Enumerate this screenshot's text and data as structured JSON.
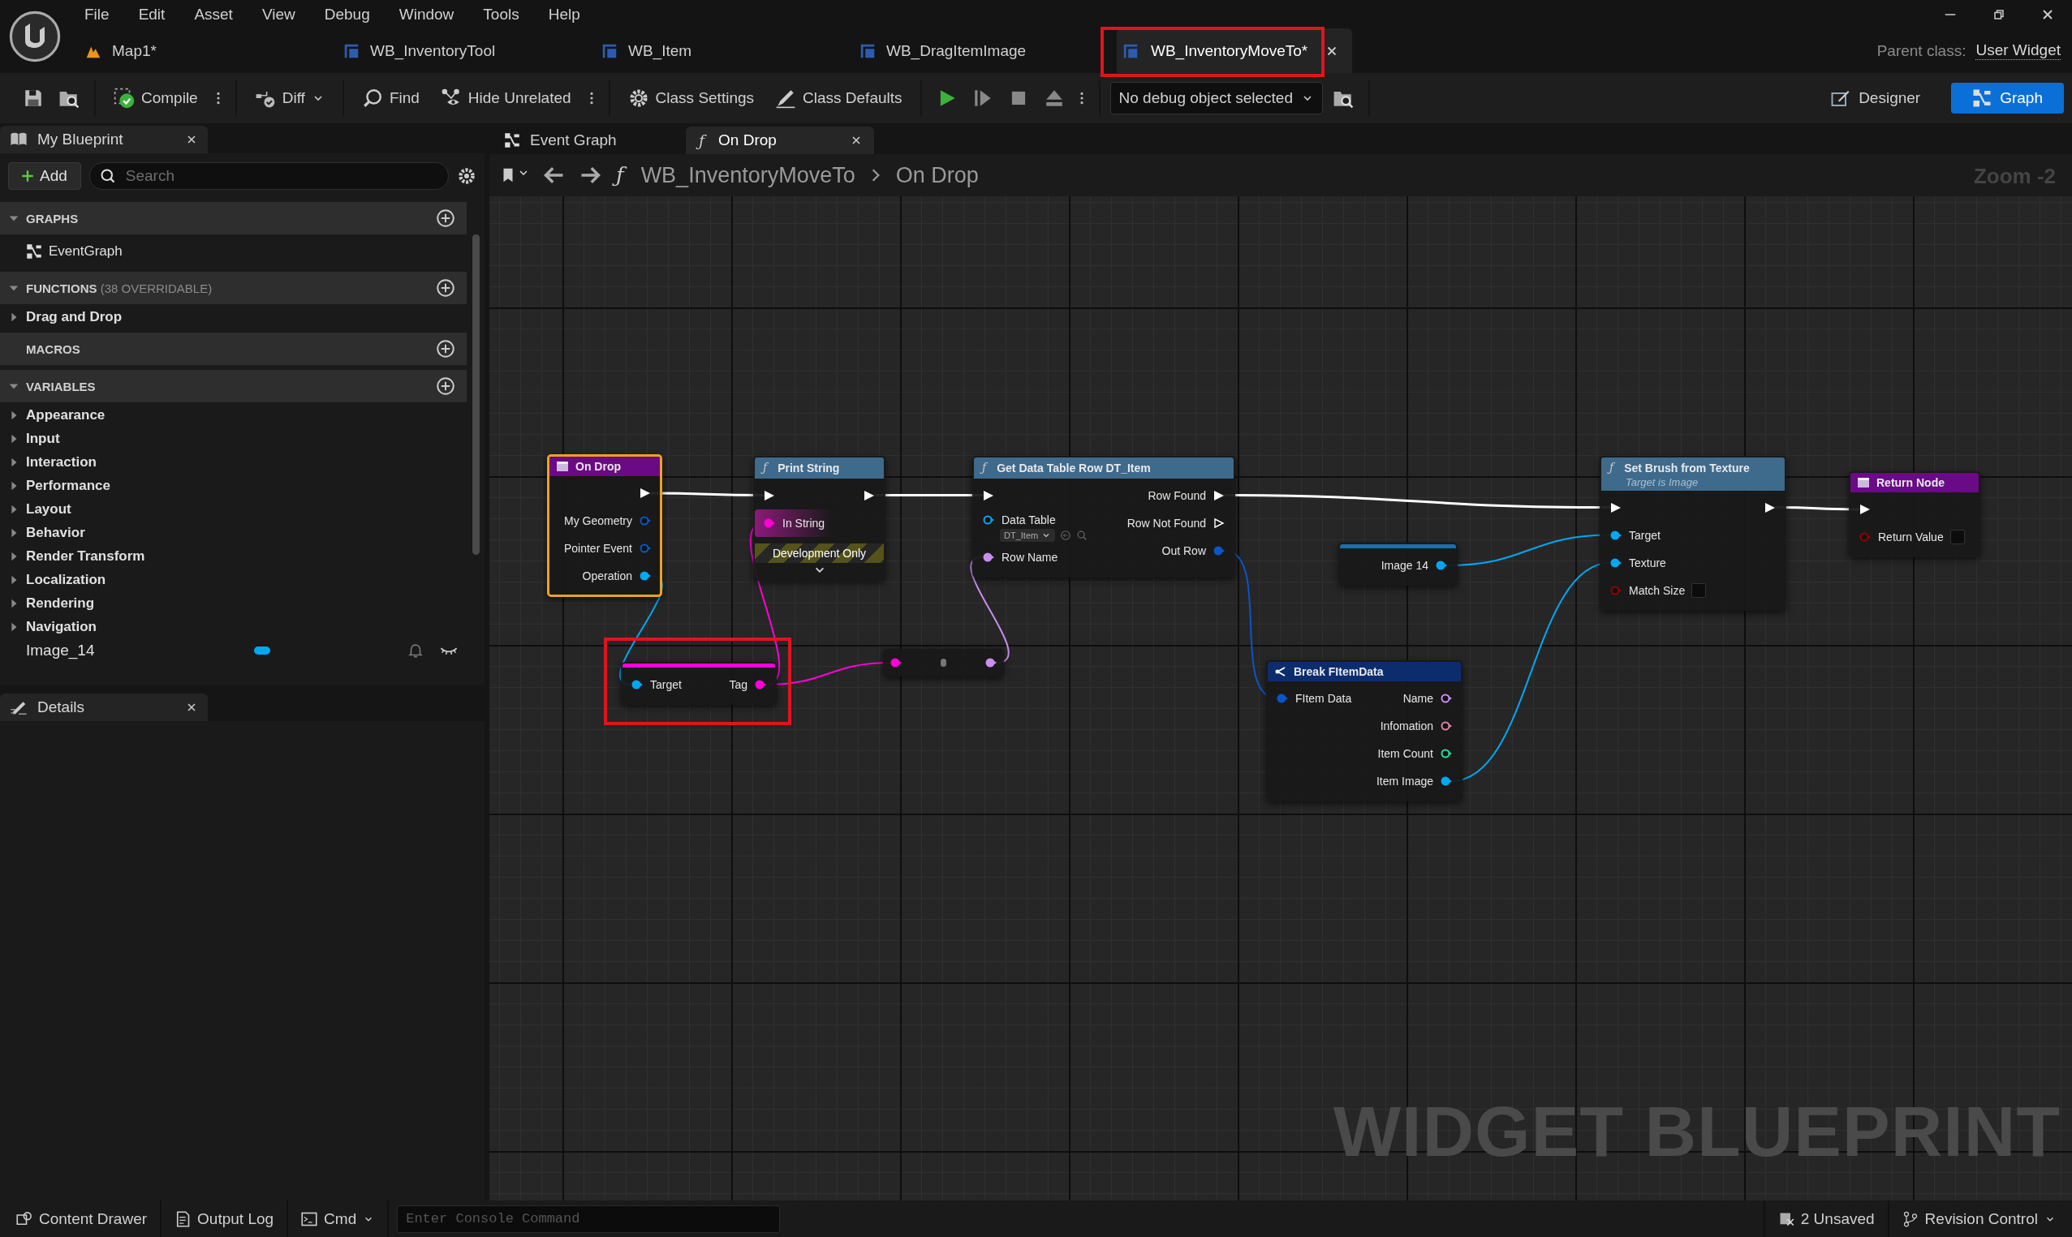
{
  "menu": [
    "File",
    "Edit",
    "Asset",
    "View",
    "Debug",
    "Window",
    "Tools",
    "Help"
  ],
  "doc_tabs": [
    {
      "label": "Map1*",
      "kind": "level",
      "selected": false,
      "highlighted": false
    },
    {
      "label": "WB_InventoryTool",
      "kind": "widget",
      "selected": false,
      "highlighted": false
    },
    {
      "label": "WB_Item",
      "kind": "widget",
      "selected": false,
      "highlighted": false
    },
    {
      "label": "WB_DragItemImage",
      "kind": "widget",
      "selected": false,
      "highlighted": false
    },
    {
      "label": "WB_InventoryMoveTo*",
      "kind": "widget",
      "selected": true,
      "highlighted": true
    }
  ],
  "parent_class": {
    "label": "Parent class:",
    "value": "User Widget"
  },
  "toolbar": [
    [
      {
        "kind": "save"
      },
      {
        "kind": "browse"
      }
    ],
    [
      {
        "kind": "compile",
        "label": "Compile"
      },
      {
        "kind": "more"
      }
    ],
    [
      {
        "kind": "diff",
        "label": "Diff"
      }
    ],
    [
      {
        "kind": "find",
        "label": "Find"
      },
      {
        "kind": "hide",
        "label": "Hide Unrelated"
      },
      {
        "kind": "more"
      }
    ],
    [
      {
        "kind": "settings",
        "label": "Class Settings"
      },
      {
        "kind": "defaults",
        "label": "Class Defaults"
      }
    ],
    [
      {
        "kind": "play"
      },
      {
        "kind": "step"
      },
      {
        "kind": "stop"
      },
      {
        "kind": "eject"
      },
      {
        "kind": "more"
      }
    ],
    [
      {
        "kind": "debug",
        "label": "No debug object selected"
      },
      {
        "kind": "browse"
      }
    ]
  ],
  "modes": [
    {
      "label": "Designer",
      "kind": "designer",
      "selected": false
    },
    {
      "label": "Graph",
      "kind": "graph",
      "selected": true
    }
  ],
  "my_blueprint": {
    "title": "My Blueprint",
    "add": "Add",
    "search_placeholder": "Search",
    "sections": [
      {
        "title": "GRAPHS",
        "expanded": true,
        "items": [
          {
            "kind": "graph",
            "label": "EventGraph"
          }
        ]
      },
      {
        "title": "FUNCTIONS",
        "note": "(38 OVERRIDABLE)",
        "expanded": true,
        "items": [
          {
            "kind": "category",
            "label": "Drag and Drop",
            "expanded": false
          }
        ]
      },
      {
        "title": "MACROS"
      },
      {
        "title": "VARIABLES",
        "expanded": true,
        "items": [
          {
            "kind": "category",
            "label": "Appearance",
            "expanded": false
          },
          {
            "kind": "category",
            "label": "Input",
            "expanded": false
          },
          {
            "kind": "category",
            "label": "Interaction",
            "expanded": false
          },
          {
            "kind": "category",
            "label": "Performance",
            "expanded": false
          },
          {
            "kind": "category",
            "label": "Layout",
            "expanded": false
          },
          {
            "kind": "category",
            "label": "Behavior",
            "expanded": false
          },
          {
            "kind": "category",
            "label": "Render Transform",
            "expanded": false
          },
          {
            "kind": "category",
            "label": "Localization",
            "expanded": false
          },
          {
            "kind": "category",
            "label": "Rendering",
            "expanded": false
          },
          {
            "kind": "category",
            "label": "Navigation",
            "expanded": false
          },
          {
            "kind": "variable",
            "label": "Image_14",
            "color": "#00a8f4"
          }
        ]
      }
    ]
  },
  "details": {
    "title": "Details"
  },
  "graph_tabs": [
    {
      "label": "Event Graph",
      "kind": "graph",
      "selected": false
    },
    {
      "label": "On Drop",
      "kind": "function",
      "glyph": "ƒ",
      "selected": true
    }
  ],
  "breadcrumb": {
    "glyph": "ƒ",
    "path": [
      "WB_InventoryMoveTo",
      "On Drop"
    ]
  },
  "zoom": "Zoom -2",
  "nodes": [
    {
      "kind": "event",
      "title": "On Drop",
      "selected": true,
      "highlighted": false,
      "outputs": [
        {
          "kind": "exec",
          "connected": true
        },
        {
          "label": "My Geometry",
          "kind": "data",
          "color": "#0a56c8",
          "connected": false
        },
        {
          "label": "Pointer Event",
          "kind": "data",
          "color": "#0a56c8",
          "connected": false
        },
        {
          "label": "Operation",
          "kind": "data",
          "color": "#00a8f4",
          "connected": true
        }
      ]
    },
    {
      "kind": "function",
      "title": "Print String",
      "glyph": "ƒ",
      "dev_only": "Development Only",
      "selected": false,
      "highlighted": false,
      "inputs": [
        {
          "kind": "exec",
          "connected": true
        },
        {
          "label": "In String",
          "kind": "data",
          "color": "#ff00d8",
          "connected": true,
          "hovered": true
        }
      ],
      "outputs": [
        {
          "kind": "exec",
          "connected": true
        }
      ]
    },
    {
      "kind": "function",
      "title": "Get Data Table Row DT_Item",
      "glyph": "ƒ",
      "selected": false,
      "highlighted": false,
      "inputs": [
        {
          "kind": "exec",
          "connected": true
        },
        {
          "label": "Data Table",
          "kind": "data",
          "color": "#00a8f4",
          "connected": false,
          "value": "DT_Item"
        },
        {
          "label": "Row Name",
          "kind": "data",
          "color": "#c88ff0",
          "connected": true
        }
      ],
      "outputs": [
        {
          "label": "Row Found",
          "kind": "exec",
          "connected": true
        },
        {
          "label": "Row Not Found",
          "kind": "exec",
          "connected": false
        },
        {
          "label": "Out Row",
          "kind": "data",
          "color": "#0a56c8",
          "connected": true
        }
      ]
    },
    {
      "kind": "getter",
      "selected": false,
      "highlighted": true,
      "inputs": [
        {
          "label": "Target",
          "kind": "data",
          "color": "#00a8f4",
          "connected": true
        }
      ],
      "outputs": [
        {
          "label": "Tag",
          "kind": "data",
          "color": "#ff00d8",
          "connected": true
        }
      ]
    },
    {
      "kind": "convert",
      "selected": false,
      "highlighted": false,
      "inputs": [
        {
          "kind": "data",
          "color": "#ff00d8",
          "connected": true
        }
      ],
      "outputs": [
        {
          "kind": "data",
          "color": "#c88ff0",
          "connected": true
        }
      ]
    },
    {
      "kind": "variable",
      "selected": false,
      "highlighted": false,
      "outputs": [
        {
          "label": "Image 14",
          "kind": "data",
          "color": "#00a8f4",
          "connected": true
        }
      ]
    },
    {
      "kind": "break",
      "title": "Break FItemData",
      "selected": false,
      "highlighted": false,
      "inputs": [
        {
          "label": "FItem Data",
          "kind": "data",
          "color": "#0a56c8",
          "connected": true
        }
      ],
      "outputs": [
        {
          "label": "Name",
          "kind": "data",
          "color": "#c88ff0",
          "connected": false
        },
        {
          "label": "Infomation",
          "kind": "data",
          "color": "#e080a8",
          "connected": false
        },
        {
          "label": "Item Count",
          "kind": "data",
          "color": "#1fe0a0",
          "connected": false
        },
        {
          "label": "Item Image",
          "kind": "data",
          "color": "#00a8f4",
          "connected": true
        }
      ]
    },
    {
      "kind": "function",
      "title": "Set Brush from Texture",
      "subtitle": "Target is Image",
      "glyph": "ƒ",
      "selected": false,
      "highlighted": false,
      "inputs": [
        {
          "kind": "exec",
          "connected": true
        },
        {
          "label": "Target",
          "kind": "data",
          "color": "#00a8f4",
          "connected": true
        },
        {
          "label": "Texture",
          "kind": "data",
          "color": "#00a8f4",
          "connected": true
        },
        {
          "label": "Match Size",
          "kind": "data",
          "color": "#950000",
          "connected": false,
          "checked": false
        }
      ],
      "outputs": [
        {
          "kind": "exec",
          "connected": true
        }
      ]
    },
    {
      "kind": "return",
      "title": "Return Node",
      "selected": false,
      "highlighted": false,
      "inputs": [
        {
          "kind": "exec",
          "connected": true
        },
        {
          "label": "Return Value",
          "kind": "data",
          "color": "#950000",
          "connected": false,
          "checked": false
        }
      ]
    }
  ],
  "canvas_label": "WIDGET BLUEPRINT",
  "status_bar": {
    "left": [
      {
        "kind": "drawer",
        "label": "Content Drawer"
      },
      {
        "kind": "log",
        "label": "Output Log"
      },
      {
        "kind": "cmd",
        "label": "Cmd"
      }
    ],
    "console_placeholder": "Enter Console Command",
    "right": [
      {
        "kind": "unsaved",
        "label": "2 Unsaved"
      },
      {
        "kind": "revision",
        "label": "Revision Control"
      }
    ]
  }
}
